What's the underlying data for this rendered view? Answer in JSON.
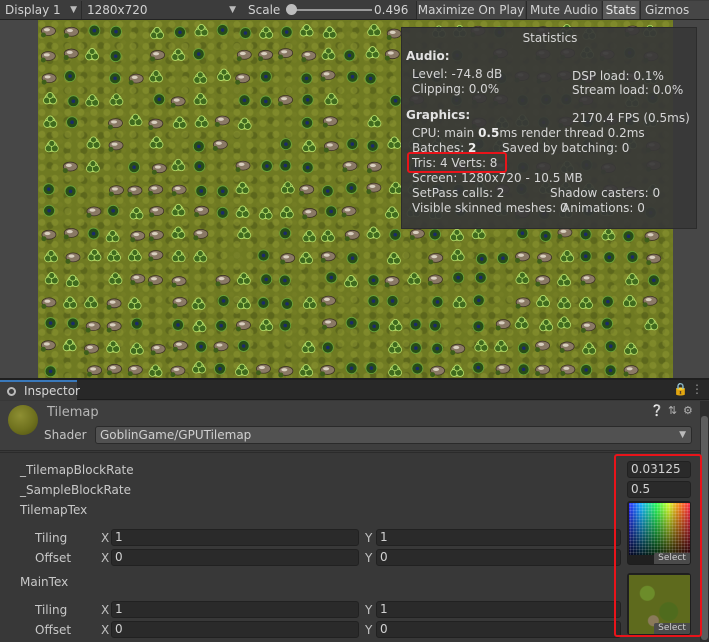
{
  "toolbar": {
    "display": "Display 1",
    "resolution": "1280x720",
    "scale_label": "Scale",
    "scale_value": "0.496",
    "scale_level": 0.0,
    "maximize_on_play": "Maximize On Play",
    "mute_audio": "Mute Audio",
    "stats": "Stats",
    "gizmos": "Gizmos"
  },
  "statistics": {
    "title": "Statistics",
    "audio_header": "Audio:",
    "level": "Level: -74.8 dB",
    "dsp_load": "DSP load: 0.1%",
    "clipping": "Clipping: 0.0%",
    "stream_load": "Stream load: 0.0%",
    "graphics_header": "Graphics:",
    "fps": "2170.4 FPS (0.5ms)",
    "cpu_prefix": "CPU: main ",
    "cpu_main": "0.5",
    "cpu_suffix": "ms  render thread 0.2ms",
    "batches_prefix": "Batches: ",
    "batches": "2",
    "saved_by_batching": "Saved by batching: 0",
    "tris_verts": "Tris: 4  Verts: 8",
    "screen": "Screen: 1280x720 - 10.5 MB",
    "setpass": "SetPass calls: 2",
    "shadow_casters": "Shadow casters: 0",
    "skinned_meshes": "Visible skinned meshes: 0",
    "animations": "Animations: 0"
  },
  "inspector": {
    "tab_label": "Inspector",
    "material_name": "Tilemap",
    "shader_label": "Shader",
    "shader_value": "GoblinGame/GPUTilemap",
    "properties": {
      "block_rate_label": "_TilemapBlockRate",
      "block_rate_value": "0.03125",
      "sample_rate_label": "_SampleBlockRate",
      "sample_rate_value": "0.5",
      "tilemap_tex_label": "TilemapTex",
      "main_tex_label": "MainTex",
      "tiling_label": "Tiling",
      "offset_label": "Offset",
      "x_label": "X",
      "y_label": "Y",
      "tilemap_tiling_x": "1",
      "tilemap_tiling_y": "1",
      "tilemap_offset_x": "0",
      "tilemap_offset_y": "0",
      "main_tiling_x": "1",
      "main_tiling_y": "1",
      "main_offset_x": "0",
      "main_offset_y": "0",
      "select_label": "Select"
    }
  },
  "colors": {
    "highlight": "#e8141a",
    "grass": "#6f7a22",
    "tab_accent": "#3a79bb"
  },
  "icons": [
    "lock-icon",
    "menu-icon",
    "help-icon",
    "preset-icon",
    "settings-icon",
    "dropdown-arrow-icon"
  ]
}
